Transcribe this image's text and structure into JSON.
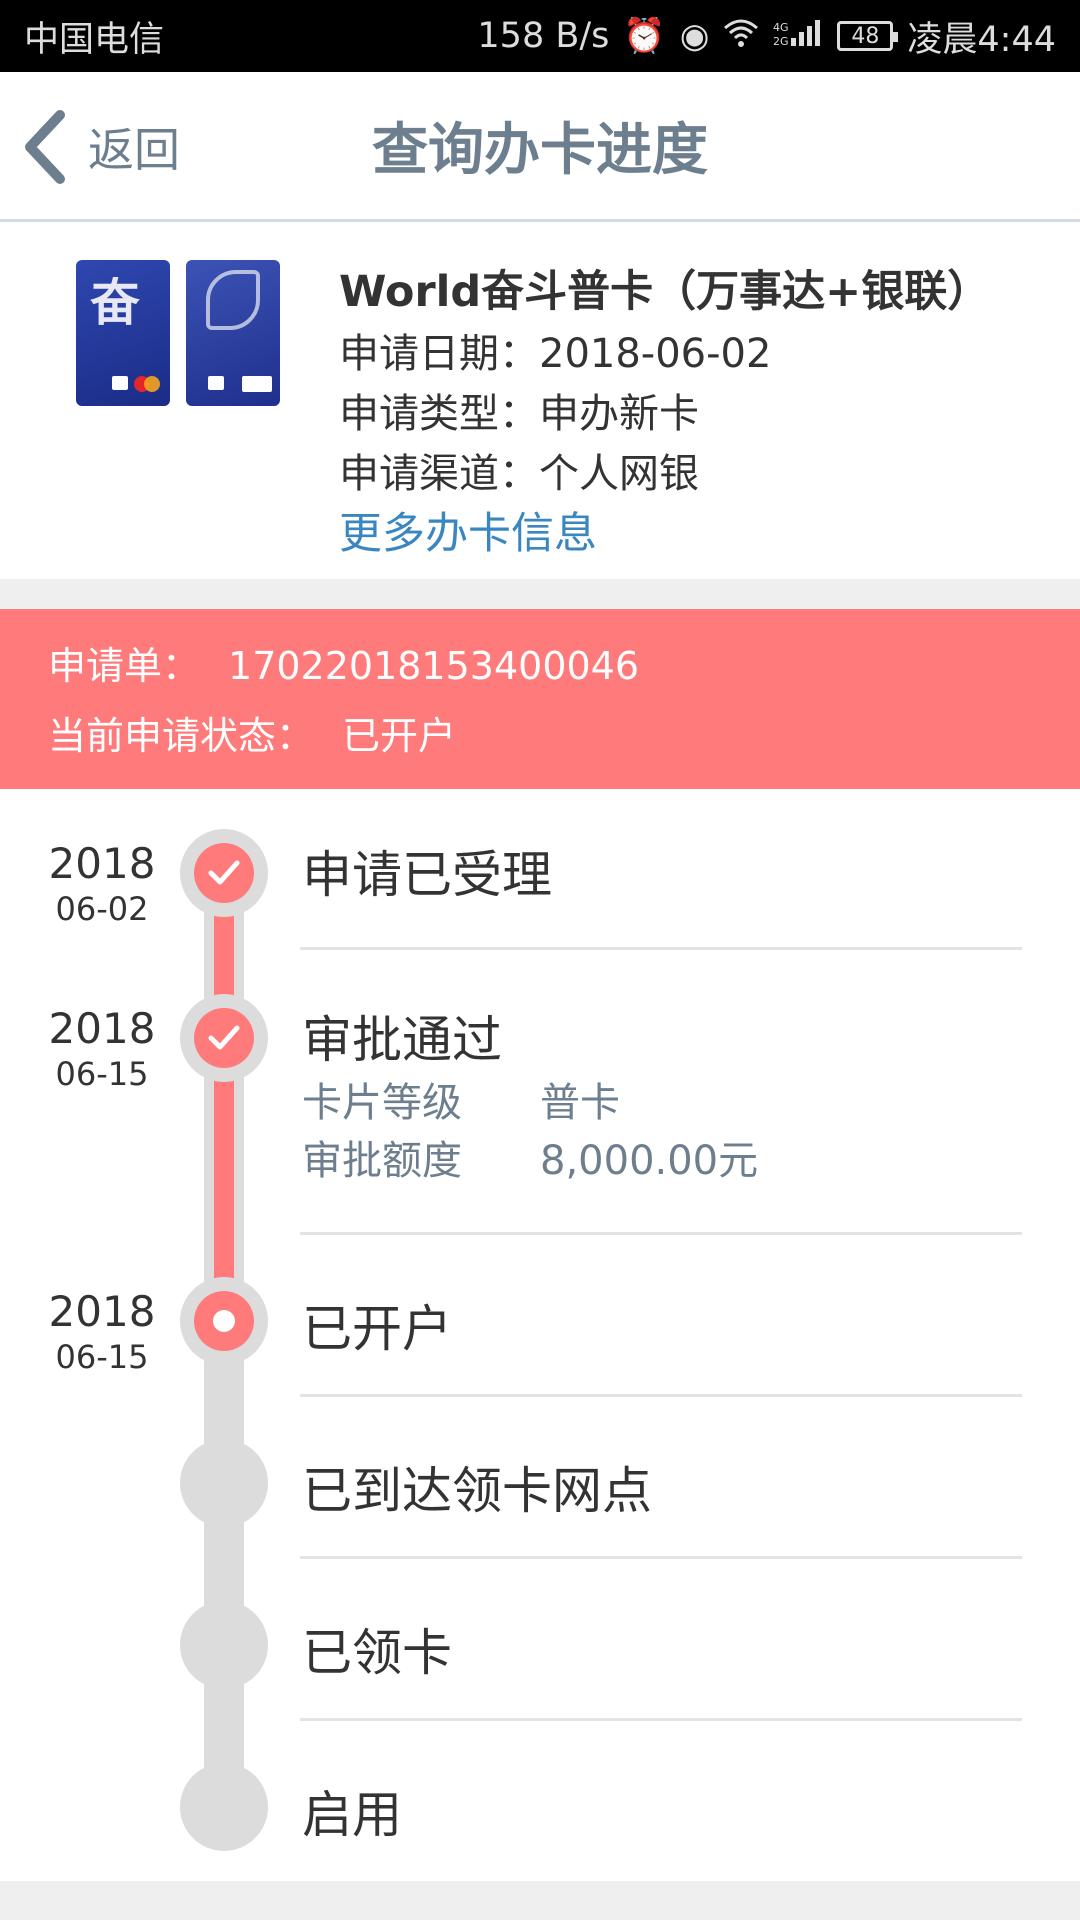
{
  "status_bar": {
    "carrier": "中国电信",
    "speed": "158 B/s",
    "battery": "48",
    "time": "凌晨4:44"
  },
  "header": {
    "back_label": "返回",
    "title": "查询办卡进度"
  },
  "card_info": {
    "name": "World奋斗普卡（万事达+银联）",
    "apply_date": "申请日期：2018-06-02",
    "apply_type": "申请类型：申办新卡",
    "apply_channel": "申请渠道：个人网银",
    "more_link": "更多办卡信息"
  },
  "banner": {
    "order_label": "申请单：",
    "order_number": "17022018153400046",
    "status_label": "当前申请状态：",
    "status_value": "已开户"
  },
  "timeline": {
    "steps": [
      {
        "year": "2018",
        "md": "06-02",
        "title": "申请已受理",
        "state": "done"
      },
      {
        "year": "2018",
        "md": "06-15",
        "title": "审批通过",
        "state": "done",
        "details": [
          {
            "key": "卡片等级",
            "value": "普卡"
          },
          {
            "key": "审批额度",
            "value": "8,000.00元"
          }
        ]
      },
      {
        "year": "2018",
        "md": "06-15",
        "title": "已开户",
        "state": "current"
      },
      {
        "year": "",
        "md": "",
        "title": "已到达领卡网点",
        "state": "pending"
      },
      {
        "year": "",
        "md": "",
        "title": "已领卡",
        "state": "pending"
      },
      {
        "year": "",
        "md": "",
        "title": "启用",
        "state": "pending"
      }
    ]
  },
  "colors": {
    "accent_red": "#ff7b7b",
    "header_text": "#6d7f8f",
    "link_blue": "#3a86c0",
    "track_gray": "#dcdcdc"
  }
}
